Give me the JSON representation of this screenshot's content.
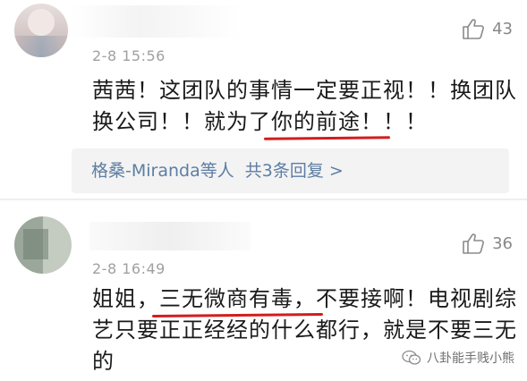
{
  "comments": [
    {
      "timestamp": "2-8 15:56",
      "likes": "43",
      "line1": "茜茜！这团队的事情一定要正视！！换团队",
      "line2_pre": "换公司！！就为了",
      "line2_marked": "你的前途！",
      "line2_post": "！！",
      "replies": {
        "names": "格桑-Miranda等人",
        "count_label": "共3条回复 >"
      }
    },
    {
      "timestamp": "2-8 16:49",
      "likes": "36",
      "line1_pre": "姐姐，",
      "line1_marked": "三无微商有毒，",
      "line1_post": "不要接啊！电视剧综",
      "line2": "艺只要正正经经的什么都行，就是不要三无",
      "line3": "的"
    }
  ],
  "watermark": "八卦能手贱小熊",
  "icons": {
    "like": "thumbs-up-icon",
    "watermark_logo": "wechat-icon"
  },
  "colors": {
    "link": "#5d7ea3",
    "underline": "#d21d1d",
    "muted": "#a0a0a0"
  }
}
